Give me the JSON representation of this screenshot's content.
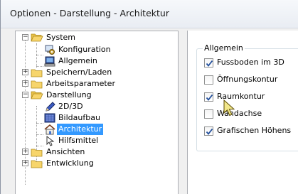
{
  "window": {
    "title": "Optionen - Darstellung - Architektur"
  },
  "tree": {
    "items": [
      {
        "label": "System",
        "expanded": true
      },
      {
        "label": "Konfiguration"
      },
      {
        "label": "Allgemein"
      },
      {
        "label": "Speichern/Laden",
        "expanded": false
      },
      {
        "label": "Arbeitsparameter",
        "expanded": false
      },
      {
        "label": "Darstellung",
        "expanded": true
      },
      {
        "label": "2D/3D"
      },
      {
        "label": "Bildaufbau"
      },
      {
        "label": "Architektur",
        "selected": true
      },
      {
        "label": "Hilfsmittel"
      },
      {
        "label": "Ansichten",
        "expanded": false
      },
      {
        "label": "Entwicklung",
        "expanded": false
      }
    ],
    "expand_glyph": "+",
    "collapse_glyph": "−"
  },
  "panel": {
    "group_title": "Allgemein",
    "checkboxes": [
      {
        "label": "Fussboden im 3D",
        "checked": true
      },
      {
        "label": "Öffnungskontur",
        "checked": false
      },
      {
        "label": "Raumkontur",
        "checked": true
      },
      {
        "label": "Wandachse",
        "checked": false
      },
      {
        "label": "Grafischen Höhens",
        "checked": true
      }
    ]
  },
  "colors": {
    "selection": "#3399ff",
    "folder": "#f7d56b",
    "check": "#1e4c9a"
  }
}
